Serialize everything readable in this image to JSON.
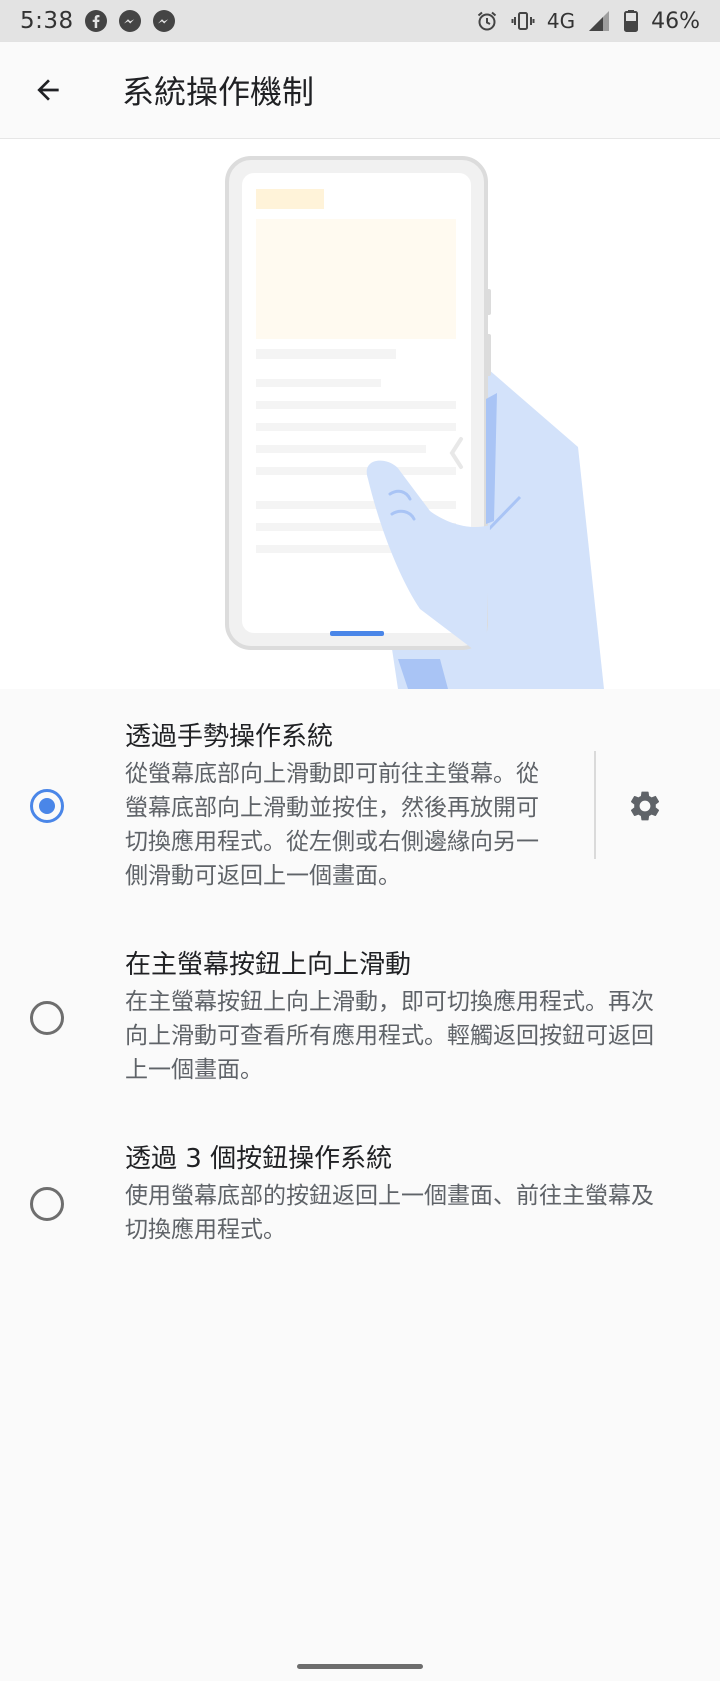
{
  "status_bar": {
    "time": "5:38",
    "network": "4G",
    "battery": "46%",
    "notification_icons": [
      "facebook-icon",
      "messenger-icon",
      "messenger-icon"
    ],
    "system_icons": [
      "alarm-icon",
      "vibrate-icon",
      "signal-icon",
      "battery-icon"
    ]
  },
  "header": {
    "title": "系統操作機制",
    "back_icon": "arrow-back-icon"
  },
  "options": [
    {
      "title": "透過手勢操作系統",
      "description_lines": [
        "從螢幕底部向上滑動即可前往主螢幕。從",
        "螢幕底部向上滑動並按住，然後再放開可",
        "切換應用程式。從左側或右側邊緣向另一",
        "側滑動可返回上一個畫面。"
      ],
      "selected": true,
      "settings_icon": "gear-icon"
    },
    {
      "title": "在主螢幕按鈕上向上滑動",
      "description_lines": [
        "在主螢幕按鈕上向上滑動，即可切換應用程式。再次",
        "向上滑動可查看所有應用程式。輕觸返回按鈕可返回",
        "上一個畫面。"
      ],
      "selected": false
    },
    {
      "title": "透過 3 個按鈕操作系統",
      "description_lines": [
        "使用螢幕底部的按鈕返回上一個畫面、前往主螢幕及",
        "切換應用程式。"
      ],
      "selected": false
    }
  ],
  "colors": {
    "accent": "#4a86e8",
    "hand": "#d3e2fa",
    "hand_shadow": "#a9c4f5",
    "nav_pill": "#4a86e8",
    "placeholder_yellow": "#fff6e0"
  }
}
